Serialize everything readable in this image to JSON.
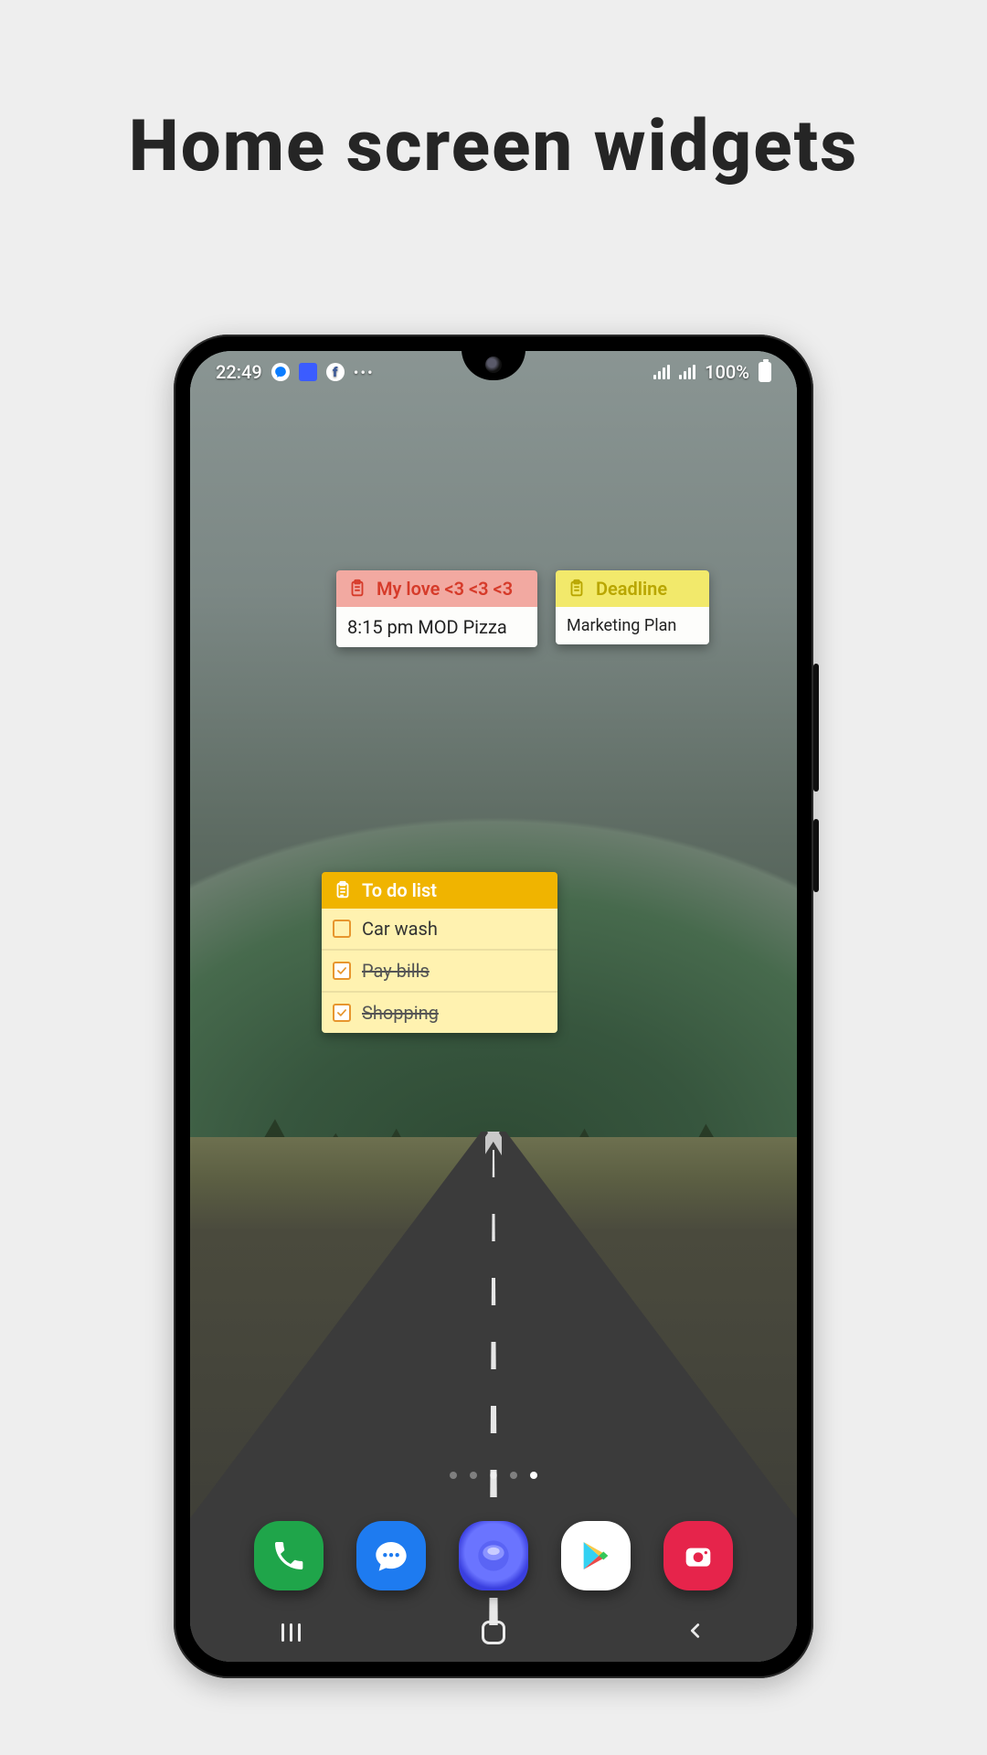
{
  "headline": "Home screen widgets",
  "status": {
    "time": "22:49",
    "battery": "100%"
  },
  "widgets": {
    "love": {
      "title": "My love <3 <3 <3",
      "body": "8:15 pm MOD Pizza"
    },
    "deadline": {
      "title": "Deadline",
      "body": "Marketing Plan"
    },
    "todo": {
      "title": "To do list",
      "items": [
        {
          "label": "Car wash",
          "done": false
        },
        {
          "label": "Pay bills",
          "done": true
        },
        {
          "label": "Shopping",
          "done": true
        }
      ]
    }
  },
  "dock": {
    "phone": "phone-app-icon",
    "messages": "messages-app-icon",
    "browser": "browser-app-icon",
    "play": "play-store-app-icon",
    "camera": "camera-app-icon"
  },
  "pager": {
    "count": 5,
    "active": 4
  }
}
